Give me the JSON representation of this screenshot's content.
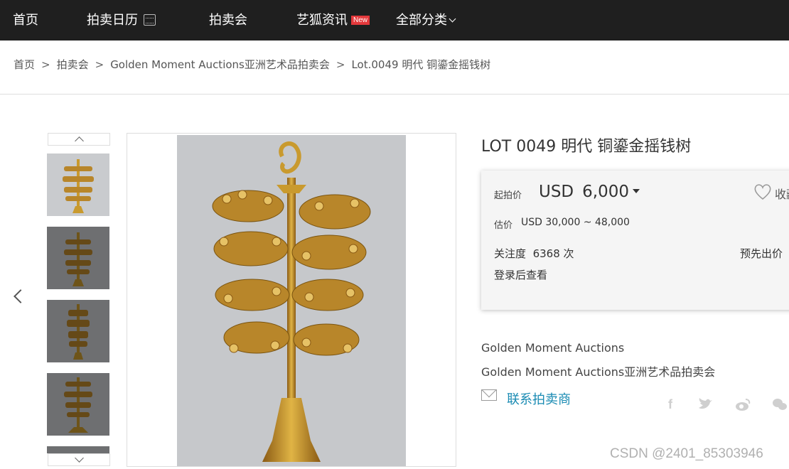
{
  "nav": {
    "home": "首页",
    "calendar": "拍卖日历",
    "auctions": "拍卖会",
    "news": "艺狐资讯",
    "news_badge": "New",
    "categories": "全部分类"
  },
  "breadcrumb": {
    "home": "首页",
    "auctions": "拍卖会",
    "sale": "Golden Moment Auctions亚洲艺术品拍卖会",
    "lot": "Lot.0049  明代 铜鎏金摇钱树",
    "separator": ">"
  },
  "lot": {
    "title": "LOT 0049 明代 铜鎏金摇钱树",
    "start_label": "起拍价",
    "currency": "USD",
    "start_price": "6,000",
    "favorite_label": "收藏",
    "estimate_label": "估价",
    "estimate": "USD  30,000 ~ 48,000",
    "attention_label": "关注度",
    "attention_value": "6368 次",
    "bid_label": "预先出价",
    "login_prompt": "登录后查看"
  },
  "seller": {
    "house": "Golden Moment Auctions",
    "sale": "Golden Moment Auctions亚洲艺术品拍卖会",
    "contact": "联系拍卖商"
  },
  "share_icons": [
    "facebook-icon",
    "twitter-icon",
    "weibo-icon",
    "wechat-icon"
  ],
  "watermark": "CSDN @2401_85303946",
  "colors": {
    "nav_bg": "#1f1f1f",
    "badge": "#e4393c",
    "link": "#1a8bb3",
    "gold": "#c99a2e"
  }
}
